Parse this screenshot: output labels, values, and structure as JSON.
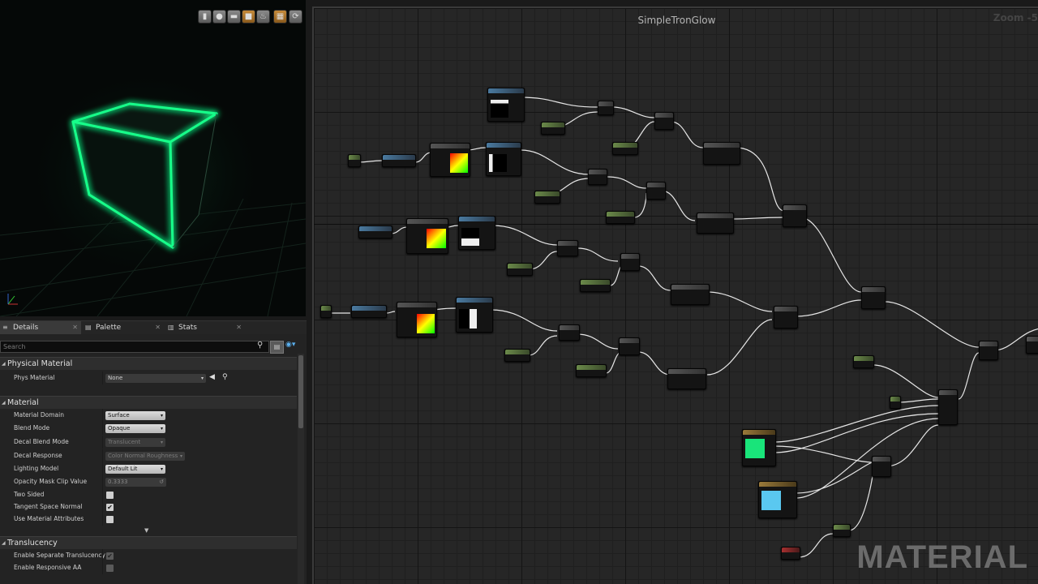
{
  "viewport": {
    "toolbar_icons": [
      "cylinder-icon",
      "sphere-icon",
      "plane-icon",
      "cube-icon",
      "teapot-icon",
      "mesh-icon",
      "realtime-icon"
    ]
  },
  "tabs": [
    {
      "label": "Details",
      "icon": "details-icon"
    },
    {
      "label": "Palette",
      "icon": "palette-icon"
    },
    {
      "label": "Stats",
      "icon": "stats-icon"
    }
  ],
  "details": {
    "search_placeholder": "Search",
    "physical_material": {
      "header": "Physical Material",
      "phys_material_label": "Phys Material",
      "phys_material_value": "None"
    },
    "material": {
      "header": "Material",
      "rows": [
        {
          "label": "Material Domain",
          "value": "Surface",
          "type": "combo",
          "enabled": true
        },
        {
          "label": "Blend Mode",
          "value": "Opaque",
          "type": "combo",
          "enabled": true
        },
        {
          "label": "Decal Blend Mode",
          "value": "Translucent",
          "type": "combo",
          "enabled": false
        },
        {
          "label": "Decal Response",
          "value": "Color Normal Roughness",
          "type": "combo",
          "enabled": false
        },
        {
          "label": "Lighting Model",
          "value": "Default Lit",
          "type": "combo",
          "enabled": true
        },
        {
          "label": "Opacity Mask Clip Value",
          "value": "0.3333",
          "type": "number",
          "enabled": false
        },
        {
          "label": "Two Sided",
          "checked": false,
          "type": "check",
          "enabled": true
        },
        {
          "label": "Tangent Space Normal",
          "checked": true,
          "type": "check",
          "enabled": true
        },
        {
          "label": "Use Material Attributes",
          "checked": false,
          "type": "check",
          "enabled": true
        }
      ]
    },
    "translucency": {
      "header": "Translucency",
      "rows": [
        {
          "label": "Enable Separate Translucency",
          "checked": true
        },
        {
          "label": "Enable Responsive AA",
          "checked": false
        }
      ]
    }
  },
  "graph": {
    "title": "SimpleTronGlow",
    "zoom": "Zoom -5",
    "watermark": "MATERIAL"
  },
  "colors": {
    "glow": "#19ff8a",
    "emissive_swatch": "#19e47a",
    "base_swatch": "#5ac8f0"
  }
}
